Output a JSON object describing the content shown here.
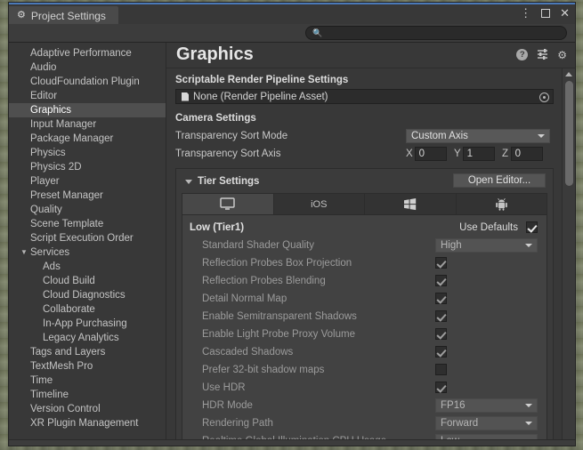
{
  "window": {
    "tab_title": "Project Settings",
    "tab_icon": "gear-icon",
    "controls": {
      "menu": "⋮",
      "maximize": "maximize-icon",
      "close": "✕"
    }
  },
  "search": {
    "value": "",
    "placeholder": "",
    "icon": "search-icon"
  },
  "sidebar": {
    "items": [
      {
        "label": "Adaptive Performance",
        "level": 0,
        "selected": false,
        "expander": ""
      },
      {
        "label": "Audio",
        "level": 0,
        "selected": false,
        "expander": ""
      },
      {
        "label": "CloudFoundation Plugin",
        "level": 0,
        "selected": false,
        "expander": ""
      },
      {
        "label": "Editor",
        "level": 0,
        "selected": false,
        "expander": ""
      },
      {
        "label": "Graphics",
        "level": 0,
        "selected": true,
        "expander": ""
      },
      {
        "label": "Input Manager",
        "level": 0,
        "selected": false,
        "expander": ""
      },
      {
        "label": "Package Manager",
        "level": 0,
        "selected": false,
        "expander": ""
      },
      {
        "label": "Physics",
        "level": 0,
        "selected": false,
        "expander": ""
      },
      {
        "label": "Physics 2D",
        "level": 0,
        "selected": false,
        "expander": ""
      },
      {
        "label": "Player",
        "level": 0,
        "selected": false,
        "expander": ""
      },
      {
        "label": "Preset Manager",
        "level": 0,
        "selected": false,
        "expander": ""
      },
      {
        "label": "Quality",
        "level": 0,
        "selected": false,
        "expander": ""
      },
      {
        "label": "Scene Template",
        "level": 0,
        "selected": false,
        "expander": ""
      },
      {
        "label": "Script Execution Order",
        "level": 0,
        "selected": false,
        "expander": ""
      },
      {
        "label": "Services",
        "level": 0,
        "selected": false,
        "expander": "▼"
      },
      {
        "label": "Ads",
        "level": 1,
        "selected": false,
        "expander": ""
      },
      {
        "label": "Cloud Build",
        "level": 1,
        "selected": false,
        "expander": ""
      },
      {
        "label": "Cloud Diagnostics",
        "level": 1,
        "selected": false,
        "expander": ""
      },
      {
        "label": "Collaborate",
        "level": 1,
        "selected": false,
        "expander": ""
      },
      {
        "label": "In-App Purchasing",
        "level": 1,
        "selected": false,
        "expander": ""
      },
      {
        "label": "Legacy Analytics",
        "level": 1,
        "selected": false,
        "expander": ""
      },
      {
        "label": "Tags and Layers",
        "level": 0,
        "selected": false,
        "expander": ""
      },
      {
        "label": "TextMesh Pro",
        "level": 0,
        "selected": false,
        "expander": ""
      },
      {
        "label": "Time",
        "level": 0,
        "selected": false,
        "expander": ""
      },
      {
        "label": "Timeline",
        "level": 0,
        "selected": false,
        "expander": ""
      },
      {
        "label": "Version Control",
        "level": 0,
        "selected": false,
        "expander": ""
      },
      {
        "label": "XR Plugin Management",
        "level": 0,
        "selected": false,
        "expander": ""
      }
    ]
  },
  "main": {
    "title": "Graphics",
    "header_icons": {
      "help": "?",
      "preset": "preset-icon",
      "settings": "gear-icon"
    },
    "srp": {
      "section_label": "Scriptable Render Pipeline Settings",
      "asset_value": "None (Render Pipeline Asset)",
      "picker_icon": "object-picker-icon"
    },
    "camera": {
      "section_label": "Camera Settings",
      "sort_mode_label": "Transparency Sort Mode",
      "sort_mode_value": "Custom Axis",
      "sort_axis_label": "Transparency Sort Axis",
      "axis": [
        {
          "name": "X",
          "value": "0"
        },
        {
          "name": "Y",
          "value": "1"
        },
        {
          "name": "Z",
          "value": "0"
        }
      ]
    },
    "tier": {
      "foldout_label": "Tier Settings",
      "foldout_arrow": "▼",
      "open_editor_label": "Open Editor...",
      "platform_tabs": [
        {
          "label": "",
          "icon": "desktop-icon",
          "active": true
        },
        {
          "label": "iOS",
          "icon": "",
          "active": false
        },
        {
          "label": "",
          "icon": "windows-icon",
          "active": false
        },
        {
          "label": "",
          "icon": "android-icon",
          "active": false
        }
      ],
      "tier_name": "Low (Tier1)",
      "use_defaults_label": "Use Defaults",
      "use_defaults_checked": true,
      "settings": [
        {
          "label": "Standard Shader Quality",
          "type": "dropdown",
          "value": "High"
        },
        {
          "label": "Reflection Probes Box Projection",
          "type": "checkbox",
          "checked": true
        },
        {
          "label": "Reflection Probes Blending",
          "type": "checkbox",
          "checked": true
        },
        {
          "label": "Detail Normal Map",
          "type": "checkbox",
          "checked": true
        },
        {
          "label": "Enable Semitransparent Shadows",
          "type": "checkbox",
          "checked": true
        },
        {
          "label": "Enable Light Probe Proxy Volume",
          "type": "checkbox",
          "checked": true
        },
        {
          "label": "Cascaded Shadows",
          "type": "checkbox",
          "checked": true
        },
        {
          "label": "Prefer 32-bit shadow maps",
          "type": "checkbox",
          "checked": false
        },
        {
          "label": "Use HDR",
          "type": "checkbox",
          "checked": true
        },
        {
          "label": "HDR Mode",
          "type": "dropdown",
          "value": "FP16"
        },
        {
          "label": "Rendering Path",
          "type": "dropdown",
          "value": "Forward"
        },
        {
          "label": "Realtime Global Illumination CPU Usage",
          "type": "dropdown",
          "value": "Low"
        }
      ]
    }
  },
  "colors": {
    "window_bg": "#383838",
    "panel_bg": "#424242",
    "accent_tab": "#4a79b8",
    "selection": "#4f4f4f",
    "dropdown_bg": "#585858",
    "field_bg": "#2c2c2c"
  }
}
